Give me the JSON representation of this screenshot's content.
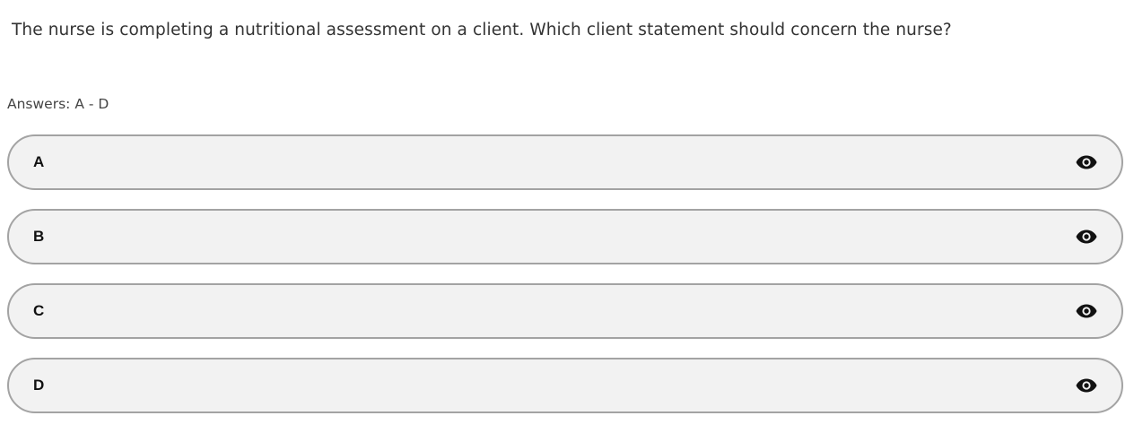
{
  "question": {
    "text": "The nurse is completing a nutritional assessment on a client. Which client statement should concern the nurse?"
  },
  "answers_label": "Answers: A - D",
  "options": [
    {
      "letter": "A",
      "icon": "eye-icon"
    },
    {
      "letter": "B",
      "icon": "eye-icon"
    },
    {
      "letter": "C",
      "icon": "eye-icon"
    },
    {
      "letter": "D",
      "icon": "eye-icon"
    }
  ]
}
